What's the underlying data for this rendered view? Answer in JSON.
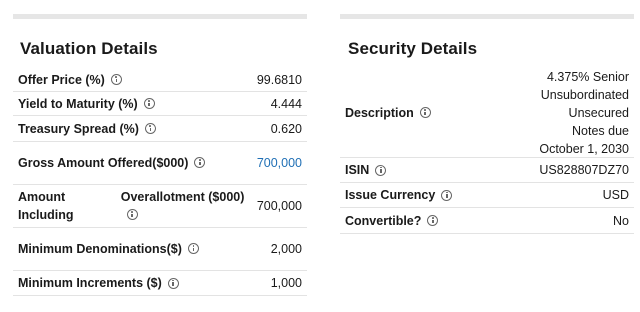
{
  "valuation": {
    "title": "Valuation Details",
    "rows": [
      {
        "label": "Offer Price (%)",
        "value": "99.6810"
      },
      {
        "label": "Yield to Maturity (%)",
        "value": "4.444"
      },
      {
        "label": "Treasury Spread (%)",
        "value": "0.620"
      },
      {
        "label_line1": "Gross Amount Offered",
        "label_line2": "($000)",
        "value": "700,000"
      },
      {
        "label_line1": "Amount Including",
        "label_line2": "Overallotment ($000)",
        "value": "700,000"
      },
      {
        "label_line1": "Minimum Denominations",
        "label_line2": "($)",
        "value": "2,000"
      },
      {
        "label": "Minimum Increments ($)",
        "value": "1,000"
      }
    ]
  },
  "security": {
    "title": "Security Details",
    "rows": [
      {
        "label": "Description",
        "value_lines": [
          "4.375% Senior",
          "Unsubordinated",
          "Unsecured",
          "Notes due",
          "October 1, 2030"
        ]
      },
      {
        "label": "ISIN",
        "value": "US828807DZ70"
      },
      {
        "label": "Issue Currency",
        "value": "USD"
      },
      {
        "label": "Convertible?",
        "value": "No"
      }
    ]
  },
  "colors": {
    "link": "#1f6fb5",
    "divider": "#e3e3e3",
    "topbar": "#e6e6e6"
  },
  "icons": {
    "info": "info-circle-icon"
  }
}
